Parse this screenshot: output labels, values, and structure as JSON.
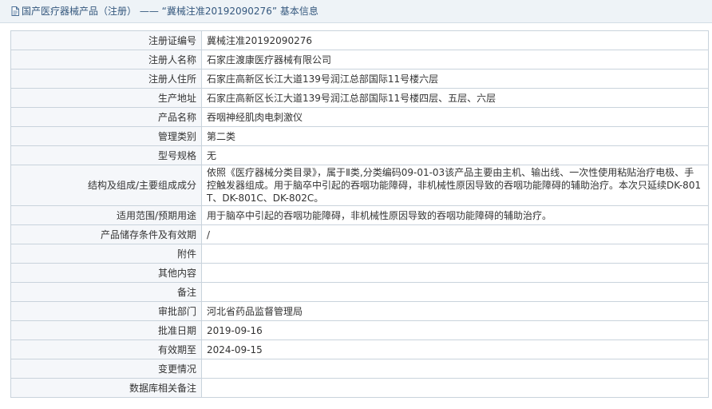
{
  "header": {
    "title": "国产医疗器械产品（注册） —— “冀械注准20192090276” 基本信息"
  },
  "rows": [
    {
      "label": "注册证编号",
      "value": "冀械注准20192090276"
    },
    {
      "label": "注册人名称",
      "value": "石家庄渡康医疗器械有限公司"
    },
    {
      "label": "注册人住所",
      "value": "石家庄高新区长江大道139号润江总部国际11号楼六层"
    },
    {
      "label": "生产地址",
      "value": "石家庄高新区长江大道139号润江总部国际11号楼四层、五层、六层"
    },
    {
      "label": "产品名称",
      "value": "吞咽神经肌肉电刺激仪"
    },
    {
      "label": "管理类别",
      "value": "第二类"
    },
    {
      "label": "型号规格",
      "value": "无"
    },
    {
      "label": "结构及组成/主要组成成分",
      "value": "依照《医疗器械分类目录》，属于Ⅱ类,分类编码09-01-03该产品主要由主机、输出线、一次性使用粘贴治疗电极、手控触发器组成。用于脑卒中引起的吞咽功能障碍，非机械性原因导致的吞咽功能障碍的辅助治疗。本次只延续DK-801T、DK-801C、DK-802C。"
    },
    {
      "label": "适用范围/预期用途",
      "value": "用于脑卒中引起的吞咽功能障碍，非机械性原因导致的吞咽功能障碍的辅助治疗。"
    },
    {
      "label": "产品储存条件及有效期",
      "value": "/"
    },
    {
      "label": "附件",
      "value": ""
    },
    {
      "label": "其他内容",
      "value": ""
    },
    {
      "label": "备注",
      "value": ""
    },
    {
      "label": "审批部门",
      "value": "河北省药品监督管理局"
    },
    {
      "label": "批准日期",
      "value": "2019-09-16"
    },
    {
      "label": "有效期至",
      "value": "2024-09-15"
    },
    {
      "label": "变更情况",
      "value": ""
    },
    {
      "label": "数据库相关备注",
      "value": ""
    }
  ]
}
